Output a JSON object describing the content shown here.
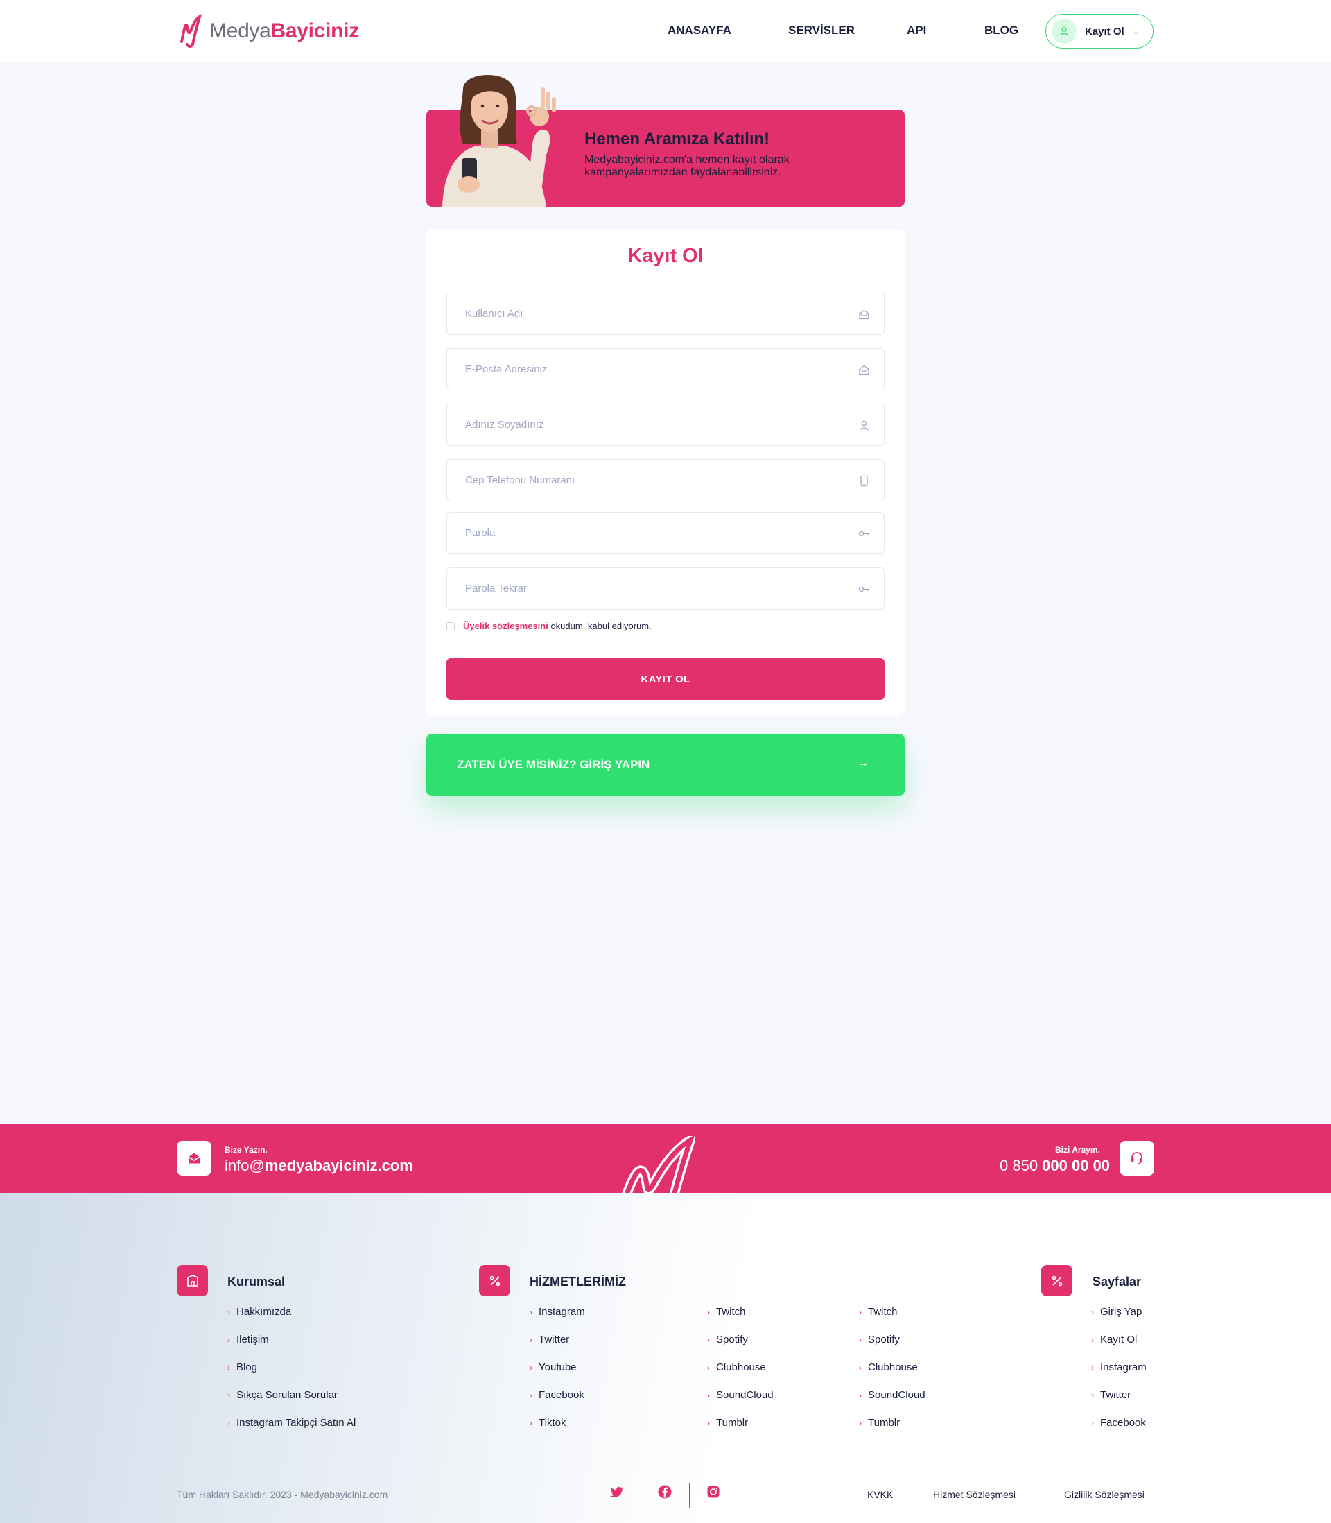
{
  "header": {
    "logo_light": "Medya",
    "logo_bold": "Bayiciniz",
    "nav": [
      "ANASAYFA",
      "SERVİSLER",
      "API",
      "BLOG"
    ],
    "register_label": "Kayıt Ol"
  },
  "hero": {
    "title": "Hemen Aramıza Katılın!",
    "text": "Medyabayiciniz.com'a hemen kayıt olarak kampanyalarımızdan faydalanabilirsiniz."
  },
  "form": {
    "title": "Kayıt Ol",
    "fields": [
      {
        "placeholder": "Kullanıcı Adı",
        "icon": "envelope-icon"
      },
      {
        "placeholder": "E-Posta Adresiniz",
        "icon": "envelope-icon"
      },
      {
        "placeholder": "Adınız Soyadınız",
        "icon": "user-icon"
      },
      {
        "placeholder": "Cep Telefonu Numaranı",
        "icon": "phone-icon"
      },
      {
        "placeholder": "Parola",
        "icon": "key-icon"
      },
      {
        "placeholder": "Parola Tekrar",
        "icon": "key-icon"
      }
    ],
    "agree_link": "Üyelik sözleşmesini",
    "agree_text": " okudum, kabul ediyorum.",
    "submit_label": "KAYIT OL"
  },
  "login_cta": {
    "label": "ZATEN ÜYE MİSİNİZ? GİRİŞ YAPIN"
  },
  "band": {
    "write_small": "Bize Yazın.",
    "email_prefix": "info@",
    "email_domain": "medyabayiciniz.com",
    "call_small": "Bizi Arayın.",
    "phone_prefix": "0 850 ",
    "phone_main": "000 00 00"
  },
  "footer": {
    "corporate": {
      "title": "Kurumsal",
      "links": [
        "Hakkımızda",
        "İletişim",
        "Blog",
        "Sıkça Sorulan Sorular",
        "Instagram Takipçi Satın Al"
      ]
    },
    "services": {
      "title": "HİZMETLERİMİZ",
      "col1": [
        "Instagram",
        "Twitter",
        "Youtube",
        "Facebook",
        "Tiktok"
      ],
      "col2": [
        "Twitch",
        "Spotify",
        "Clubhouse",
        "SoundCloud",
        "Tumblr"
      ],
      "col3": [
        "Twitch",
        "Spotify",
        "Clubhouse",
        "SoundCloud",
        "Tumblr"
      ]
    },
    "pages": {
      "title": "Sayfalar",
      "links": [
        "Giriş Yap",
        "Kayıt Ol",
        "Instagram",
        "Twitter",
        "Facebook"
      ]
    },
    "copyright": "Tüm Hakları Saklıdır. 2023 - Medyabayiciniz.com",
    "legal": [
      "KVKK",
      "Hizmet Sözleşmesi",
      "Gizlilik Sözleşmesi"
    ],
    "social": [
      "twitter-icon",
      "facebook-icon",
      "instagram-icon"
    ]
  },
  "colors": {
    "brand": "#e2306c",
    "accent_green": "#2fdf6f",
    "background": "#f7f8fe"
  }
}
